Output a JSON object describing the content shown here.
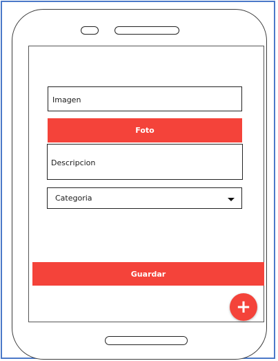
{
  "form": {
    "image_label": "Imagen",
    "photo_button": "Foto",
    "description_label": "Descripcion",
    "category_select": "Categoria",
    "save_button": "Guardar"
  },
  "fab": {
    "icon": "plus-icon",
    "symbol": "+"
  },
  "colors": {
    "accent": "#f4433a",
    "frame_border": "#4a78c8"
  }
}
